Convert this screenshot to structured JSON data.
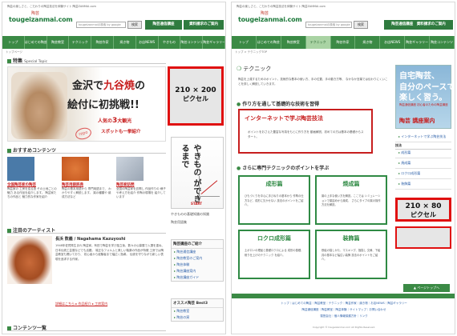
{
  "left": {
    "tagline": "陶芸の楽しさと、こだわりの陶芸技法を体験サイト 陶芸ZANMAI.com",
    "logo_badge": "陶芸",
    "logo_text": "tougeizanmai.com",
    "search_placeholder": "tougeizanmaiの検索 by google",
    "search_button": "検索",
    "promo1": "陶芸通信講座",
    "promo2": "資料請求のご案内",
    "nav": [
      "トップ",
      "はじめての陶芸",
      "陶芸教室",
      "テクニック",
      "陶芸作家",
      "焼き物",
      "やきもの",
      "お店NEWS",
      "陶芸コンテンツ",
      "陶芸ギャラリー"
    ],
    "breadcrumb": "トップページ",
    "special_head": "特集",
    "special_sub": "Special Topic",
    "banner": {
      "line1_a": "金沢で",
      "line1_red": "九谷焼",
      "line1_b": "の",
      "line2": "絵付に初挑戦!!",
      "line3_a": "人気の",
      "line3_big": "3",
      "line3_b": "大観光",
      "line4": "スポットも一挙紹介",
      "stamp": "repo"
    },
    "ad_big": {
      "size": "210 × 200",
      "unit": "ピクセル"
    },
    "osusume_head": "おすすめコンテンツ",
    "thumbs": [
      {
        "title": "全国陶芸家の陶芸",
        "desc": "陶芸家の 工房を巡る旅 その土地ごとの魅力 ある作品を紹介します。 陶芸家たちの作品と 魅力的な作家を紹介",
        "color": "#4a7aa8"
      },
      {
        "title": "陶芸用語辞典",
        "desc": "陶芸の基本用語から 専門用語まで、 わかりやすく解説します。 窯の種類や 焼成方法など",
        "color": "#d9692d"
      },
      {
        "title": "陶芸家訪問",
        "desc": "全国の陶芸家を訪問し 作品作りの 様子や考え方を紹介 作陶の現場を 紹介しています",
        "color": "#b0b8c4"
      }
    ],
    "artist_head": "注目のアーティスト",
    "artist_name": "長浜 数義 / Nagahama Kazuyoshi",
    "artist_text": "1948年佐賀県生まれ 陶芸家。有田で陶芸を学び独立後、数々の公募展で入選を重ね、 日本伝統工芸展などでも活躍。 端正なフォルムと美しい釉薬の作品が特徴 工房では陶芸教室も開いており、 初心者から経験者まで幅広く指導。 伝統を守りながら新しい表現を追求する作家。",
    "artist_link": "詳細はこちら ▸ 作品紹介 ▸ 工房案内",
    "contents_head": "コンテンツ一覧",
    "side_banner_text": "やきもの ができるまで",
    "side_banner_start": "START",
    "side_cap1": "やきものの基礎知識の知識",
    "side_cap2": "陶芸用語集",
    "side_box1_head": "陶芸講座のご紹介",
    "side_box1_items": [
      "陶芸通信講座",
      "陶芸教室のご案内",
      "陶芸体験",
      "陶芸講座案内",
      "陶芸講座ガイド"
    ],
    "side_box2_head": "オススメ陶芸 Best3",
    "side_box2_items": [
      "陶芸教室",
      "陶芸の窯"
    ]
  },
  "right": {
    "tagline": "陶芸の楽しさと、こだわりの陶芸技法を体験サイト 陶芸ZANMAI.com",
    "logo_badge": "陶芸",
    "logo_text": "tougeizanmai.com",
    "search_placeholder": "tougeizanmaiの検索 by google",
    "search_button": "検索",
    "promo": "陶芸通信講座　資料請求のご案内",
    "nav": [
      "トップ",
      "はじめての陶芸",
      "陶芸教室",
      "テクニック",
      "陶芸作家",
      "焼き物",
      "お店NEWS",
      "陶芸ギャラリー",
      "陶芸コンテンツ"
    ],
    "breadcrumb": "トップ > テクニックTOP",
    "title": "テクニック",
    "desc": "陶芸を上達するためのポイント、技術的な基本の使い方、手の位置、手の動き方等、 なかなか言葉では伝わりにくいことを詳しく解説していきます。",
    "sub1": "作り方を通して基礎的な技術を習得",
    "red_box_title": "インターネットで学ぶ陶芸技法",
    "red_box_desc": "ポイントをおさえた豊富な写真をもとに作り方を 動画解説、初めての方は基本の基礎からスタート。",
    "sub2": "さらに専門テクニックのポイントを学ぶ",
    "boxes": [
      {
        "title": "成形篇",
        "desc": "ひもづくりを中心に手びねりの基本から 作陶の仕方など、成形に欠かせない 技法のポイントをご紹介。"
      },
      {
        "title": "焼成篇",
        "desc": "窯の上手な使い方を解説。ここでは シミュレーションで窯詰めから焼成、 さらにタイプの窯の操作方法を解説。"
      },
      {
        "title": "ロクロ成形篇",
        "desc": "土ボロンの理屈と基礎ロクロによる 成形の基礎、削り仕上げのテクニック を紹介。"
      },
      {
        "title": "装飾篇",
        "desc": "鉄絵の描しかた、マスキング、指描し 文様、下絵具の基本など幅広い装飾 技法のポイントをご紹介。"
      }
    ],
    "page_top": "▲ ページトップへ",
    "footer_links1": "トップ｜はじめての陶芸｜陶芸教室｜テクニック｜陶芸作家｜焼き物｜お店NEWS｜陶芸ギャラリー",
    "footer_links2": "陶芸通信講座｜陶芸教室｜陶芸体験｜サイトマップ｜お問い合わせ",
    "footer_links3": "運営会社｜個人情報保護方針｜リンク",
    "copyright": "Copyright © tougeizanmai.com All Rights Reserved.",
    "side_banner": {
      "l1": "自宅陶芸、",
      "l2": "自分のペースで",
      "l3": "楽しく習う。",
      "l4": "陶芸通信講座 初心者のための陶芸講座",
      "l5": "陶芸 講座案内"
    },
    "side_links": [
      "インターネットで学ぶ陶芸技法"
    ],
    "side_head": "技法",
    "side_links2": [
      "成形篇",
      "焼成篇",
      "ロクロ成形篇",
      "装飾篇"
    ],
    "ad_small": {
      "size": "210 × 80",
      "unit": "ピクセル"
    }
  }
}
